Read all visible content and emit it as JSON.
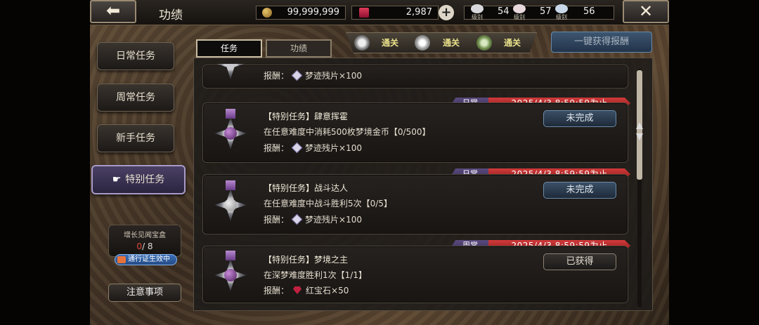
{
  "header": {
    "back_icon": "back-arrow-icon",
    "title": "功绩",
    "close_icon": "close-icon",
    "gold": "99,999,999",
    "ruby": "2,987",
    "level_label": "级别",
    "levels": [
      "54",
      "57",
      "56"
    ]
  },
  "sidebar": {
    "items": [
      {
        "label": "日常任务"
      },
      {
        "label": "周常任务"
      },
      {
        "label": "新手任务"
      },
      {
        "label": "特别任务"
      }
    ],
    "chest_title": "增长见闻宝盒",
    "chest_current": "0",
    "chest_total": "/ 8",
    "pass_label": "通行证生效中",
    "notice_label": "注意事项"
  },
  "tabs": [
    {
      "label": "任务"
    },
    {
      "label": "功绩"
    }
  ],
  "clear_label": "通关",
  "claim_all_label": "一键获得报酬",
  "quests": [
    {
      "reward": "报酬：",
      "reward_item": "梦迹残片×100"
    },
    {
      "type": "日常",
      "deadline": "2025/4/3 8:59:59为止",
      "name": "【特别任务】肆意挥霍",
      "desc": "在任意难度中消耗500枚梦境金币【0/500】",
      "reward": "报酬：",
      "reward_item": "梦迹残片×100",
      "status": "未完成"
    },
    {
      "type": "日常",
      "deadline": "2025/4/3 8:59:59为止",
      "name": "【特别任务】战斗达人",
      "desc": "在任意难度中战斗胜利5次【0/5】",
      "reward": "报酬：",
      "reward_item": "梦迹残片×100",
      "status": "未完成"
    },
    {
      "type": "周常",
      "deadline": "2025/4/3 8:59:59为止",
      "name": "【特别任务】梦境之主",
      "desc": "在深梦难度胜利1次【1/1】",
      "reward": "报酬：",
      "reward_item": "红宝石×50",
      "status": "已获得"
    }
  ]
}
